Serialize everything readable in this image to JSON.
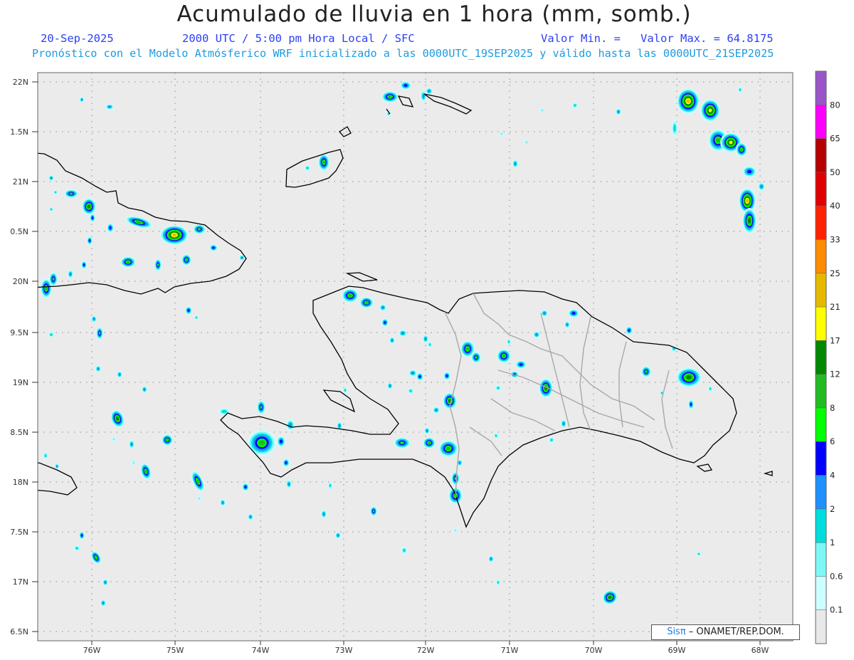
{
  "title": "Acumulado de lluvia en 1 hora (mm, somb.)",
  "date": "20-Sep-2025",
  "valid_time": "2000 UTC / 5:00 pm Hora Local / SFC",
  "min_label": "Valor Min. =",
  "max_label": "Valor Max. = 64.8175",
  "forecast_line": "Pronóstico con el Modelo Atmósferico WRF inicializado a las 0000UTC_19SEP2025 y válido hasta las  0000UTC_21SEP2025",
  "credit_brand": "Sisπ",
  "credit_rest": " – ONAMET/REP.DOM.",
  "lat_labels": [
    "22N",
    "1.5N",
    "21N",
    "0.5N",
    "20N",
    "9.5N",
    "19N",
    "8.5N",
    "18N",
    "7.5N",
    "17N",
    "6.5N"
  ],
  "lon_labels": [
    "76W",
    "75W",
    "74W",
    "73W",
    "72W",
    "71W",
    "70W",
    "69W",
    "68W"
  ],
  "colorbar": {
    "labels": [
      "80",
      "65",
      "50",
      "40",
      "33",
      "25",
      "21",
      "17",
      "12",
      "8",
      "6",
      "4",
      "2",
      "1",
      "0.6",
      "0.1"
    ],
    "colors": [
      "#9a55c8",
      "#ff00ff",
      "#b50000",
      "#e00000",
      "#ff2200",
      "#ff8c00",
      "#e6b800",
      "#ffff00",
      "#008800",
      "#22bb22",
      "#00ff00",
      "#0000ff",
      "#1e90ff",
      "#00dddd",
      "#7ff7f7",
      "#ccffff",
      "#e8e8e8"
    ]
  },
  "colors": {
    "background": "#ebebeb",
    "coast": "#000000",
    "border": "#a8a8a8"
  }
}
